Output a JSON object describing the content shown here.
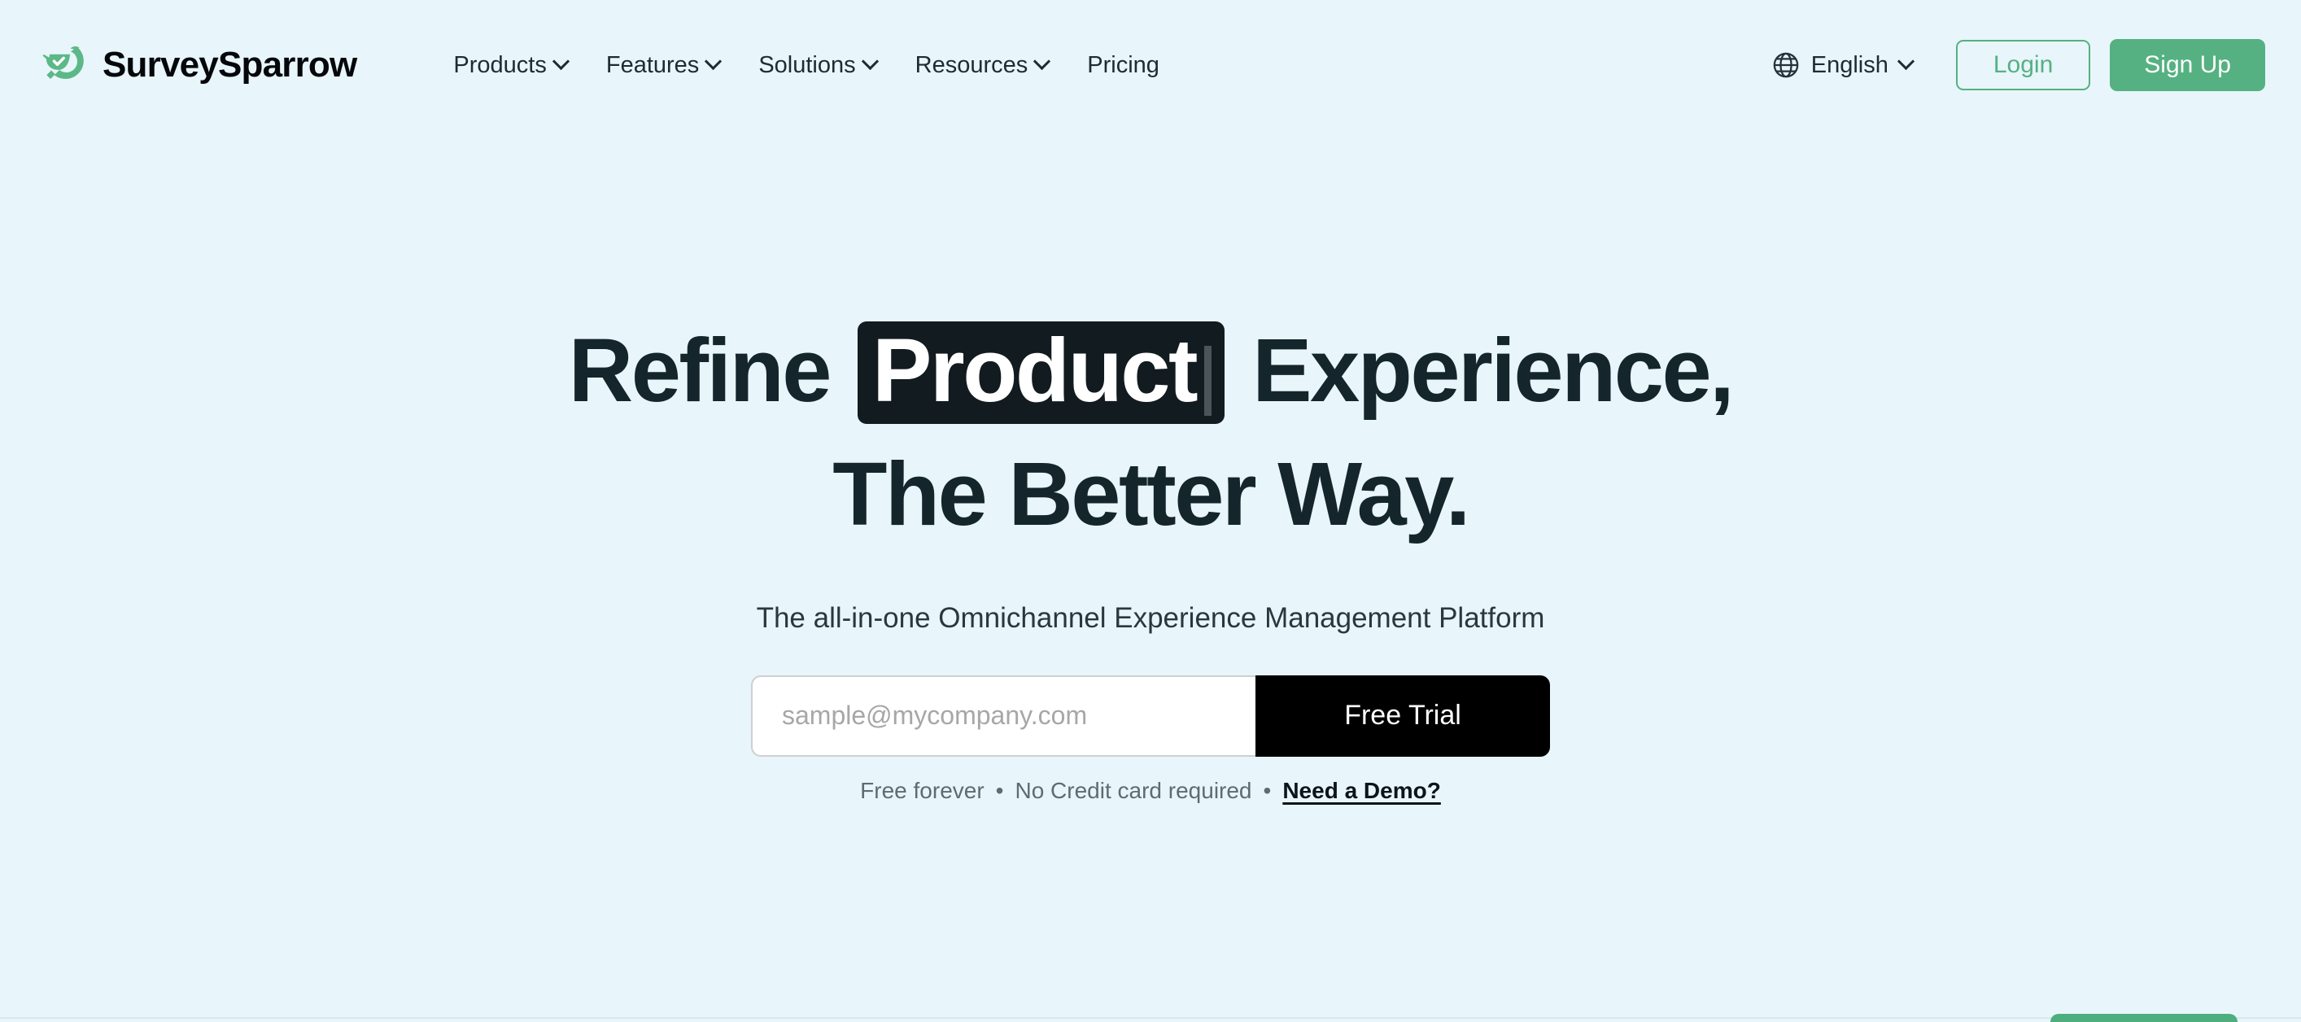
{
  "colors": {
    "background": "#e8f5fb",
    "brand_green": "#55b181",
    "heading_dark": "#14252b",
    "highlight_box": "#121b1f",
    "trial_button": "#000000"
  },
  "header": {
    "logo_icon": "surveysparrow-bird-logo",
    "brand_name": "SurveySparrow",
    "nav": [
      {
        "label": "Products",
        "has_dropdown": true
      },
      {
        "label": "Features",
        "has_dropdown": true
      },
      {
        "label": "Solutions",
        "has_dropdown": true
      },
      {
        "label": "Resources",
        "has_dropdown": true
      },
      {
        "label": "Pricing",
        "has_dropdown": false
      }
    ],
    "language": {
      "icon": "globe-icon",
      "label": "English",
      "has_dropdown": true
    },
    "login_label": "Login",
    "signup_label": "Sign Up"
  },
  "hero": {
    "title_prefix": "Refine",
    "title_highlight": "Product",
    "title_suffix": "Experience,",
    "title_line2": "The Better Way.",
    "subtitle": "The all-in-one Omnichannel Experience Management Platform"
  },
  "trial_form": {
    "email_placeholder": "sample@mycompany.com",
    "email_value": "",
    "submit_label": "Free Trial",
    "note_free": "Free forever",
    "note_separator": "•",
    "note_credit": "No Credit card required",
    "demo_link": "Need a Demo?"
  },
  "chat_widget": {
    "name": "chat-launcher"
  }
}
